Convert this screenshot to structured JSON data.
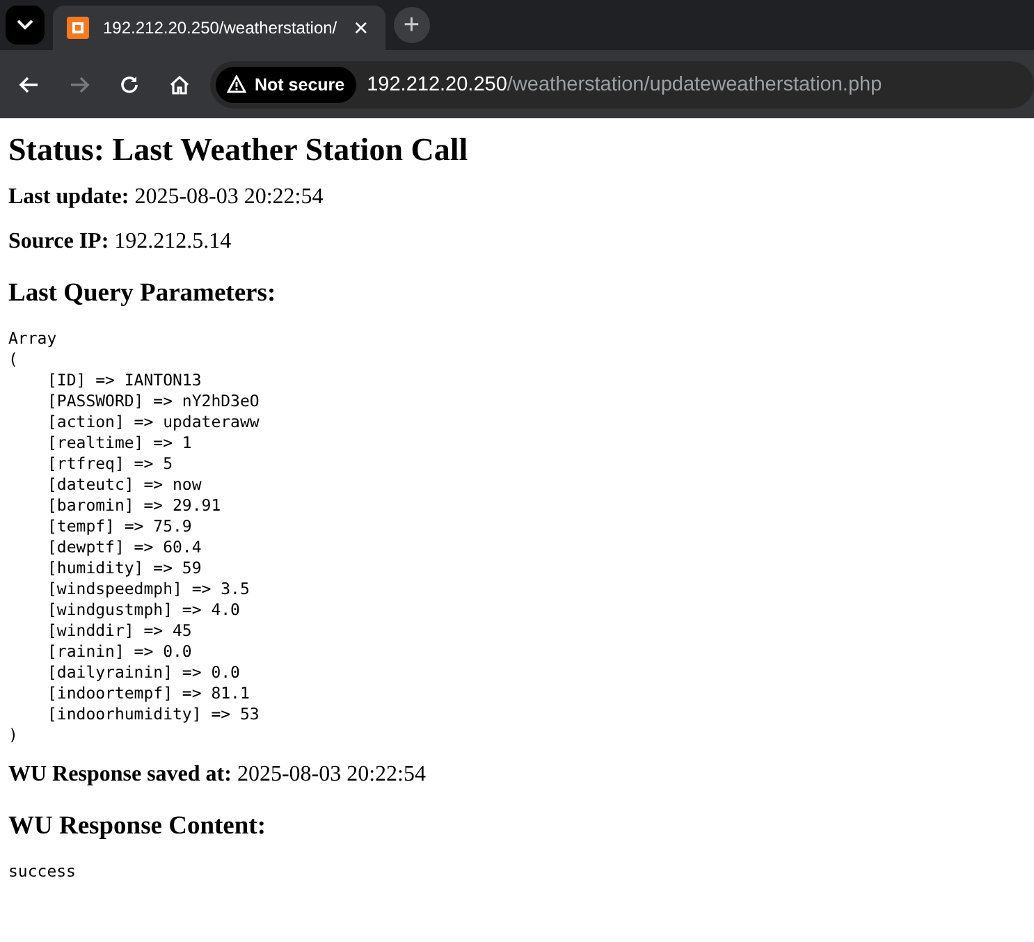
{
  "browser": {
    "tab": {
      "title": "192.212.20.250/weatherstation/",
      "close": "×"
    },
    "new_tab": "+",
    "security": "Not secure",
    "url_host": "192.212.20.250",
    "url_path": "/weatherstation/updateweatherstation.php"
  },
  "page": {
    "title": "Status: Last Weather Station Call",
    "last_update": {
      "label": "Last update:",
      "value": "2025-08-03 20:22:54"
    },
    "source_ip": {
      "label": "Source IP:",
      "value": "192.212.5.14"
    },
    "params_heading": "Last Query Parameters:",
    "array_open": [
      "Array",
      "("
    ],
    "params": [
      "[ID] => IANTON13",
      "[PASSWORD] => nY2hD3eO",
      "[action] => updateraww",
      "[realtime] => 1",
      "[rtfreq] => 5",
      "[dateutc] => now",
      "[baromin] => 29.91",
      "[tempf] => 75.9",
      "[dewptf] => 60.4",
      "[humidity] => 59",
      "[windspeedmph] => 3.5",
      "[windgustmph] => 4.0",
      "[winddir] => 45",
      "[rainin] => 0.0",
      "[dailyrainin] => 0.0",
      "[indoortempf] => 81.1",
      "[indoorhumidity] => 53"
    ],
    "array_close": ")",
    "saved_at": {
      "label": "WU Response saved at:",
      "value": "2025-08-03 20:22:54"
    },
    "content_heading": "WU Response Content:",
    "content": "success"
  }
}
